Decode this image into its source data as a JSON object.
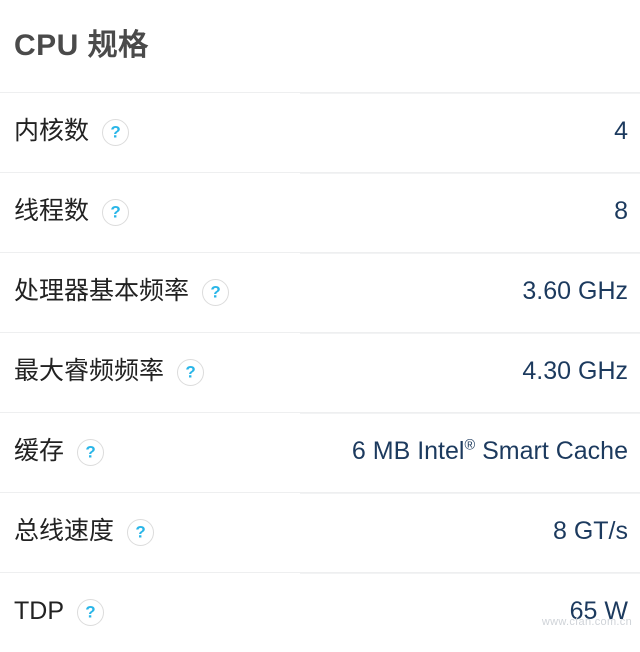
{
  "header": {
    "title": "CPU 规格"
  },
  "icons": {
    "help": {
      "name": "help-icon",
      "glyph": "?",
      "color": "#29b6e8",
      "border_color": "#dcdcdc"
    }
  },
  "colors": {
    "page_background": "#ffffff",
    "title_text": "#4a4a4a",
    "label_text": "#222222",
    "value_text": "#1c3a5e",
    "divider": "#eeeff0",
    "help_glyph": "#29b6e8",
    "watermark": "#cfd3d8"
  },
  "specs": {
    "rows": [
      {
        "label": "内核数",
        "value": "4",
        "has_help": true
      },
      {
        "label": "线程数",
        "value": "8",
        "has_help": true
      },
      {
        "label": "处理器基本频率",
        "value": "3.60 GHz",
        "has_help": true
      },
      {
        "label": "最大睿频频率",
        "value": "4.30 GHz",
        "has_help": true
      },
      {
        "label": "缓存",
        "value": "6 MB Intel® Smart Cache",
        "value_html": "6 MB Intel<sup>®</sup> Smart Cache",
        "has_help": true
      },
      {
        "label": "总线速度",
        "value": "8 GT/s",
        "has_help": true
      },
      {
        "label": "TDP",
        "value": "65 W",
        "has_help": true
      }
    ]
  },
  "watermark": {
    "text": "www.cfan.com.cn"
  }
}
